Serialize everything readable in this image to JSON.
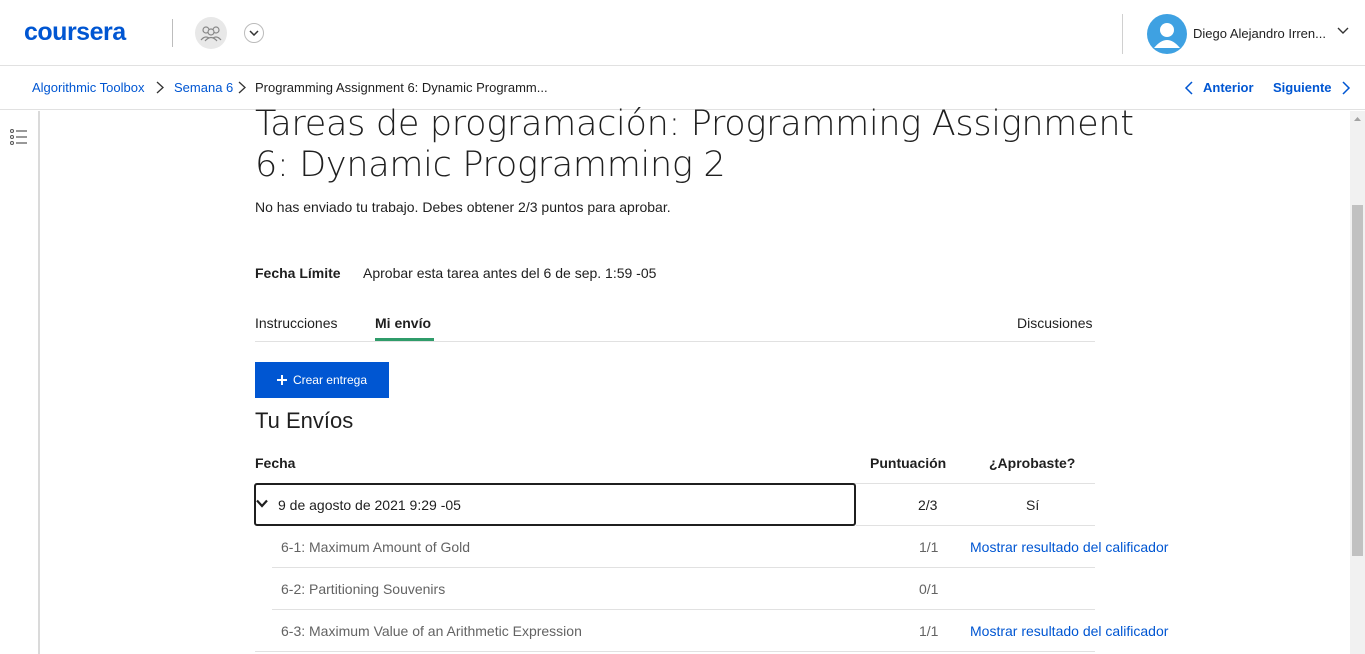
{
  "header": {
    "logo": "coursera",
    "user_name": "Diego Alejandro Irren...",
    "colors": {
      "brand": "#0056d2",
      "avatar": "#3ea1e2"
    }
  },
  "breadcrumb": {
    "items": [
      "Algorithmic Toolbox",
      "Semana 6",
      "Programming Assignment 6: Dynamic Programm..."
    ],
    "prev_label": "Anterior",
    "next_label": "Siguiente"
  },
  "main": {
    "title": "Tareas de programación: Programming Assignment 6: Dynamic Programming 2",
    "subtitle": "No has enviado tu trabajo. Debes obtener 2/3 puntos para aprobar.",
    "due_label": "Fecha Límite",
    "due_value": "Aprobar esta tarea antes del 6 de sep. 1:59 -05",
    "tabs": [
      {
        "label": "Instrucciones",
        "active": false
      },
      {
        "label": "Mi envío",
        "active": true
      },
      {
        "label": "Discusiones",
        "active": false
      }
    ],
    "create_button": "Crear entrega",
    "section_title": "Tu Envíos",
    "table": {
      "headers": [
        "Fecha",
        "Puntuación",
        "¿Aprobaste?"
      ],
      "submission": {
        "date": "9 de agosto de 2021 9:29 -05",
        "score": "2/3",
        "passed": "Sí"
      },
      "parts": [
        {
          "name": "6-1: Maximum Amount of Gold",
          "score": "1/1",
          "link": "Mostrar resultado del calificador"
        },
        {
          "name": "6-2: Partitioning Souvenirs",
          "score": "0/1",
          "link": ""
        },
        {
          "name": "6-3: Maximum Value of an Arithmetic Expression",
          "score": "1/1",
          "link": "Mostrar resultado del calificador"
        }
      ]
    }
  }
}
